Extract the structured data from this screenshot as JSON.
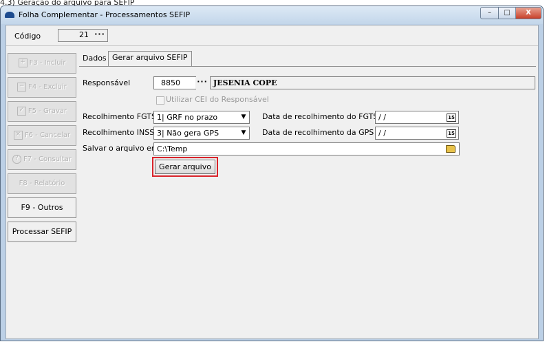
{
  "caption": "4.3) Geração do arquivo para SEFIP",
  "window": {
    "title": "Folha Complementar - Processamentos SEFIP",
    "min_glyph": "–",
    "max_glyph": "□",
    "close_glyph": "X"
  },
  "codigo": {
    "label": "Código",
    "value": "21",
    "dots": "···"
  },
  "sidebar": {
    "items": [
      {
        "label": "F3 - Incluir",
        "glyph": "+",
        "enabled": false
      },
      {
        "label": "F4 - Excluir",
        "glyph": "−",
        "enabled": false
      },
      {
        "label": "F5 - Gravar",
        "glyph": "✓",
        "enabled": false
      },
      {
        "label": "F6 - Cancelar",
        "glyph": "×",
        "enabled": false
      },
      {
        "label": "F7 - Consultar",
        "glyph": "?",
        "enabled": false
      },
      {
        "label": "F8 - Relatório",
        "glyph": "",
        "enabled": false
      },
      {
        "label": "F9 - Outros",
        "glyph": "",
        "enabled": true
      },
      {
        "label": "Processar SEFIP",
        "glyph": "",
        "enabled": true
      }
    ]
  },
  "tabs": [
    {
      "label": "Dados",
      "active": false
    },
    {
      "label": "Gerar arquivo SEFIP",
      "active": true
    }
  ],
  "form": {
    "responsavel": {
      "label": "Responsável",
      "code": "8850",
      "dots": "···",
      "name": "JESENIA COPE"
    },
    "utilizar_cei": {
      "label": "Utilizar CEI do Responsável",
      "checked": false,
      "enabled": false
    },
    "recolhimento_fgts": {
      "label": "Recolhimento FGTS",
      "value": "1| GRF no prazo",
      "arrow": "▼"
    },
    "data_fgts": {
      "label": "Data de recolhimento do FGTS",
      "value": " / /",
      "cal_text": "15"
    },
    "recolhimento_inss": {
      "label": "Recolhimento INSS",
      "value": "3| Não gera GPS",
      "arrow": "▼"
    },
    "data_gps": {
      "label": "Data de recolhimento da GPS",
      "value": " / /",
      "cal_text": "15"
    },
    "salvar": {
      "label": "Salvar o arquivo em",
      "value": "C:\\Temp"
    },
    "gerar_button": "Gerar arquivo"
  },
  "colors": {
    "highlight": "#d9232a",
    "title_accent": "#1d4b8f"
  }
}
